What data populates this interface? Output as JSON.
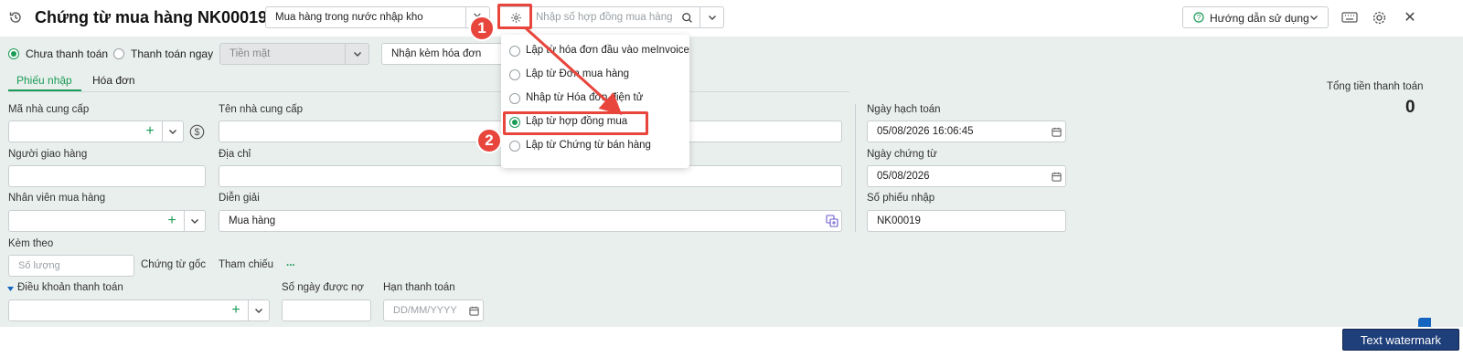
{
  "header": {
    "title": "Chứng từ mua hàng NK00019",
    "type_select": "Mua hàng trong nước nhập kho",
    "contract_search_placeholder": "Nhập số hợp đồng mua hàng",
    "help_label": "Hướng dẫn sử dụng"
  },
  "payment": {
    "unpaid_label": "Chưa thanh toán",
    "pay_now_label": "Thanh toán ngay",
    "method_value": "Tiền mặt",
    "invoice_option": "Nhận kèm hóa đơn"
  },
  "tabs": [
    {
      "label": "Phiếu nhập",
      "active": true
    },
    {
      "label": "Hóa đơn",
      "active": false
    }
  ],
  "dropdown_menu": {
    "items": [
      {
        "label": "Lập từ hóa đơn đầu vào meInvoice",
        "selected": false
      },
      {
        "label": "Lập từ Đơn mua hàng",
        "selected": false
      },
      {
        "label": "Nhập từ Hóa đơn điện tử",
        "selected": false
      },
      {
        "label": "Lập từ hợp đồng mua",
        "selected": true
      },
      {
        "label": "Lập từ Chứng từ bán hàng",
        "selected": false
      }
    ]
  },
  "annotations": {
    "step1": "1",
    "step2": "2",
    "color": "#e8453c"
  },
  "form": {
    "supplier_code_label": "Mã nhà cung cấp",
    "supplier_name_label": "Tên nhà cung cấp",
    "deliverer_label": "Người giao hàng",
    "address_label": "Địa chỉ",
    "buyer_label": "Nhân viên mua hàng",
    "description_label": "Diễn giải",
    "description_value": "Mua hàng",
    "attach_label": "Kèm theo",
    "quantity_placeholder": "Số lượng",
    "original_doc_label": "Chứng từ gốc",
    "reference_label": "Tham chiếu",
    "reference_more": "...",
    "payment_terms_label": "Điều khoản thanh toán",
    "credit_days_label": "Số ngày được nợ",
    "due_date_label": "Hạn thanh toán",
    "due_date_placeholder": "DD/MM/YYYY",
    "accounting_date_label": "Ngày hạch toán",
    "accounting_date_value": "05/08/2026 16:06:45",
    "voucher_date_label": "Ngày chứng từ",
    "voucher_date_value": "05/08/2026",
    "receipt_no_label": "Số phiếu nhập",
    "receipt_no_value": "NK00019"
  },
  "totals": {
    "label": "Tổng tiền thanh toán",
    "value": "0"
  },
  "watermark": "Text watermark",
  "colors": {
    "accent": "#1a9b55",
    "background": "#e9efed",
    "side_tab": "#1565c0"
  }
}
